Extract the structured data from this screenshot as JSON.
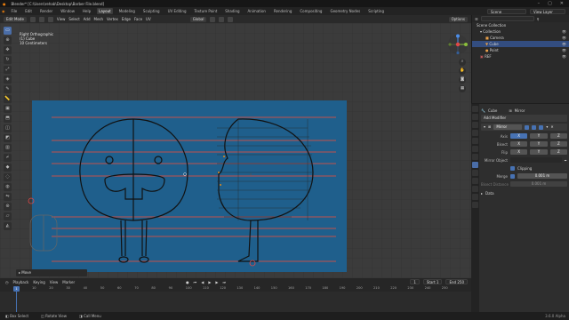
{
  "window": {
    "title": "Blender* [C:\\Users\\rehab\\Desktop\\Barber File.blend]"
  },
  "menu": {
    "items": [
      "File",
      "Edit",
      "Render",
      "Window",
      "Help"
    ]
  },
  "workspaces": [
    "Layout",
    "Modeling",
    "Sculpting",
    "UV Editing",
    "Texture Paint",
    "Shading",
    "Animation",
    "Rendering",
    "Compositing",
    "Geometry Nodes",
    "Scripting"
  ],
  "scene": {
    "name": "Scene",
    "view_layer": "View Layer"
  },
  "viewport_header": {
    "mode": "Edit Mode",
    "menus": [
      "View",
      "Select",
      "Add",
      "Mesh",
      "Vertex",
      "Edge",
      "Face",
      "UV"
    ],
    "orientation": "Global",
    "options": "Options"
  },
  "viewport": {
    "view_name": "Right Orthographic",
    "object": "(1) Cube",
    "scale": "10 Centimeters"
  },
  "last_operator": "Move",
  "timeline": {
    "menus": [
      "Playback",
      "Keying",
      "View",
      "Marker"
    ],
    "current_frame": "1",
    "start_label": "Start",
    "start": "1",
    "end_label": "End",
    "end": "250",
    "ticks": [
      "10",
      "20",
      "30",
      "40",
      "50",
      "60",
      "70",
      "80",
      "90",
      "100",
      "110",
      "120",
      "130",
      "140",
      "150",
      "160",
      "170",
      "180",
      "190",
      "200",
      "210",
      "220",
      "230",
      "240",
      "250"
    ]
  },
  "status": {
    "select": "Box Select",
    "rotate": "Rotate View",
    "menu": "Call Menu",
    "version": "3.6.0 Alpha"
  },
  "outliner": {
    "header": "Scene Collection",
    "items": [
      {
        "label": "Collection",
        "selected": false
      },
      {
        "label": "Camera",
        "selected": false
      },
      {
        "label": "Cube",
        "selected": true
      },
      {
        "label": "Point",
        "selected": false
      },
      {
        "label": "REF",
        "selected": false
      }
    ]
  },
  "properties": {
    "object": "Cube",
    "modifier_tab": "Mirror",
    "add_modifier": "Add Modifier",
    "modifier_name": "Mirror",
    "axis_label": "Axis",
    "bisect_label": "Bisect",
    "flip_label": "Flip",
    "axes": [
      "X",
      "Y",
      "Z"
    ],
    "mirror_object_label": "Mirror Object",
    "clipping_label": "Clipping",
    "merge_label": "Merge",
    "merge_value": "0.001 m",
    "bisect_distance_label": "Bisect Distance",
    "bisect_distance_value": "0.001 m",
    "data_panel": "Data"
  }
}
